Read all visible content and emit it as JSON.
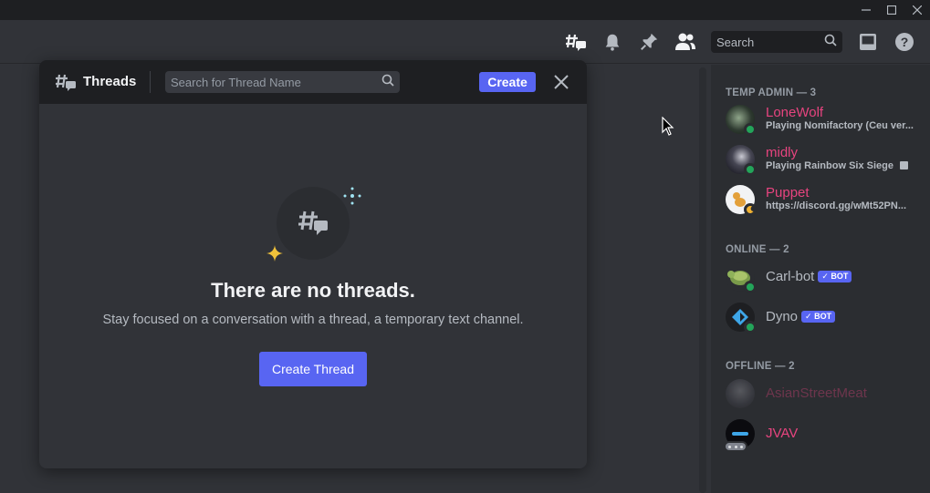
{
  "search": {
    "placeholder": "Search"
  },
  "threads": {
    "title": "Threads",
    "search_placeholder": "Search for Thread Name",
    "create_label": "Create",
    "empty_title": "There are no threads.",
    "empty_subtitle": "Stay focused on a conversation with a thread, a temporary text channel.",
    "create_thread_label": "Create Thread"
  },
  "members": {
    "groups": [
      {
        "title": "TEMP ADMIN — 3",
        "items": [
          {
            "name": "LoneWolf",
            "activity": "Playing Nomifactory (Ceu ver...",
            "status": "online"
          },
          {
            "name": "midly",
            "activity": "Playing Rainbow Six Siege",
            "status": "online"
          },
          {
            "name": "Puppet",
            "activity": "https://discord.gg/wMt52PN...",
            "status": "idle"
          }
        ]
      },
      {
        "title": "ONLINE — 2",
        "items": [
          {
            "name": "Carl-bot",
            "tag": "✓ BOT",
            "status": "online"
          },
          {
            "name": "Dyno",
            "tag": "✓ BOT",
            "status": "online"
          }
        ]
      },
      {
        "title": "OFFLINE — 2",
        "items": [
          {
            "name": "AsianStreetMeat",
            "status": "offline"
          },
          {
            "name": "JVAV",
            "status": "typing"
          }
        ]
      }
    ]
  },
  "colors": {
    "accent": "#5865f2",
    "online": "#23a55a",
    "idle": "#f0b232",
    "role_name": "#e7447f",
    "background": "#313338",
    "sidebar": "#2b2d31"
  }
}
